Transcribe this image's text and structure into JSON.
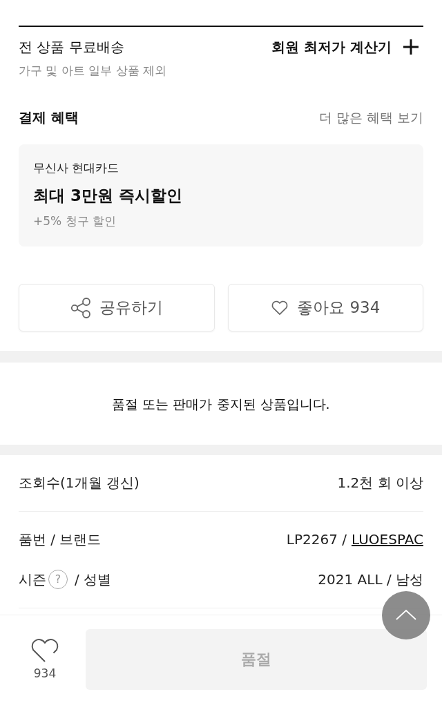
{
  "shipping": {
    "title": "전 상품 무료배송",
    "note": "가구 및 아트 일부 상품 제외",
    "calculator": "회원 최저가 계산기"
  },
  "payment_benefits": {
    "title": "결제 혜택",
    "more": "더 많은 혜택 보기",
    "card": {
      "issuer": "무신사 현대카드",
      "headline": "최대 3만원 즉시할인",
      "extra": "+5% 청구 할인"
    }
  },
  "actions": [
    {
      "kind": "share",
      "label": "공유하기"
    },
    {
      "kind": "like",
      "label": "좋아요 934"
    }
  ],
  "notice": "품절 또는 판매가 중지된 상품입니다.",
  "info_groups": [
    {
      "rows": [
        {
          "label": "조회수(1개월 갱신)",
          "value": "1.2천 회 이상"
        }
      ]
    },
    {
      "rows": [
        {
          "label": "품번 / 브랜드",
          "value": "LP2267 /",
          "link": "LUOESPAC"
        },
        {
          "label": "시즌",
          "help": "?",
          "label_suffix": "/ 성별",
          "value": "2021 ALL / 남성"
        }
      ]
    }
  ],
  "bottom_bar": {
    "like_count": "934",
    "buy_button": {
      "label": "품절",
      "disabled": true
    }
  }
}
